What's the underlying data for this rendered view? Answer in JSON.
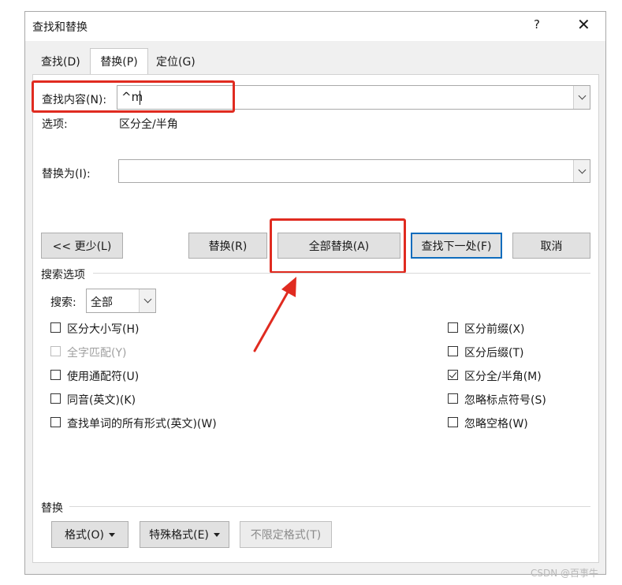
{
  "window": {
    "title": "查找和替换",
    "help_label": "?",
    "close_label": "✕"
  },
  "tabs": [
    {
      "label": "查找(D)"
    },
    {
      "label": "替换(P)"
    },
    {
      "label": "定位(G)"
    }
  ],
  "find": {
    "label": "查找内容(N):",
    "value": "^m"
  },
  "options": {
    "label": "选项:",
    "value": "区分全/半角"
  },
  "replace": {
    "label": "替换为(I):",
    "value": ""
  },
  "buttons": {
    "less": "<< 更少(L)",
    "replace": "替换(R)",
    "replace_all": "全部替换(A)",
    "find_next": "查找下一处(F)",
    "cancel": "取消"
  },
  "search_options": {
    "section_label": "搜索选项",
    "search_label": "搜索:",
    "search_value": "全部",
    "left_options": [
      {
        "label": "区分大小写(H)",
        "checked": false,
        "disabled": false
      },
      {
        "label": "全字匹配(Y)",
        "checked": false,
        "disabled": true
      },
      {
        "label": "使用通配符(U)",
        "checked": false,
        "disabled": false
      },
      {
        "label": "同音(英文)(K)",
        "checked": false,
        "disabled": false
      },
      {
        "label": "查找单词的所有形式(英文)(W)",
        "checked": false,
        "disabled": false
      }
    ],
    "right_options": [
      {
        "label": "区分前缀(X)",
        "checked": false
      },
      {
        "label": "区分后缀(T)",
        "checked": false
      },
      {
        "label": "区分全/半角(M)",
        "checked": true
      },
      {
        "label": "忽略标点符号(S)",
        "checked": false
      },
      {
        "label": "忽略空格(W)",
        "checked": false
      }
    ]
  },
  "replace_section": {
    "label": "替换",
    "format_button": "格式(O)",
    "special_button": "特殊格式(E)",
    "no_format_button": "不限定格式(T)"
  },
  "watermark": "CSDN @百事牛",
  "colors": {
    "highlight": "#e02b20",
    "primary_border": "#0f6cbd"
  }
}
